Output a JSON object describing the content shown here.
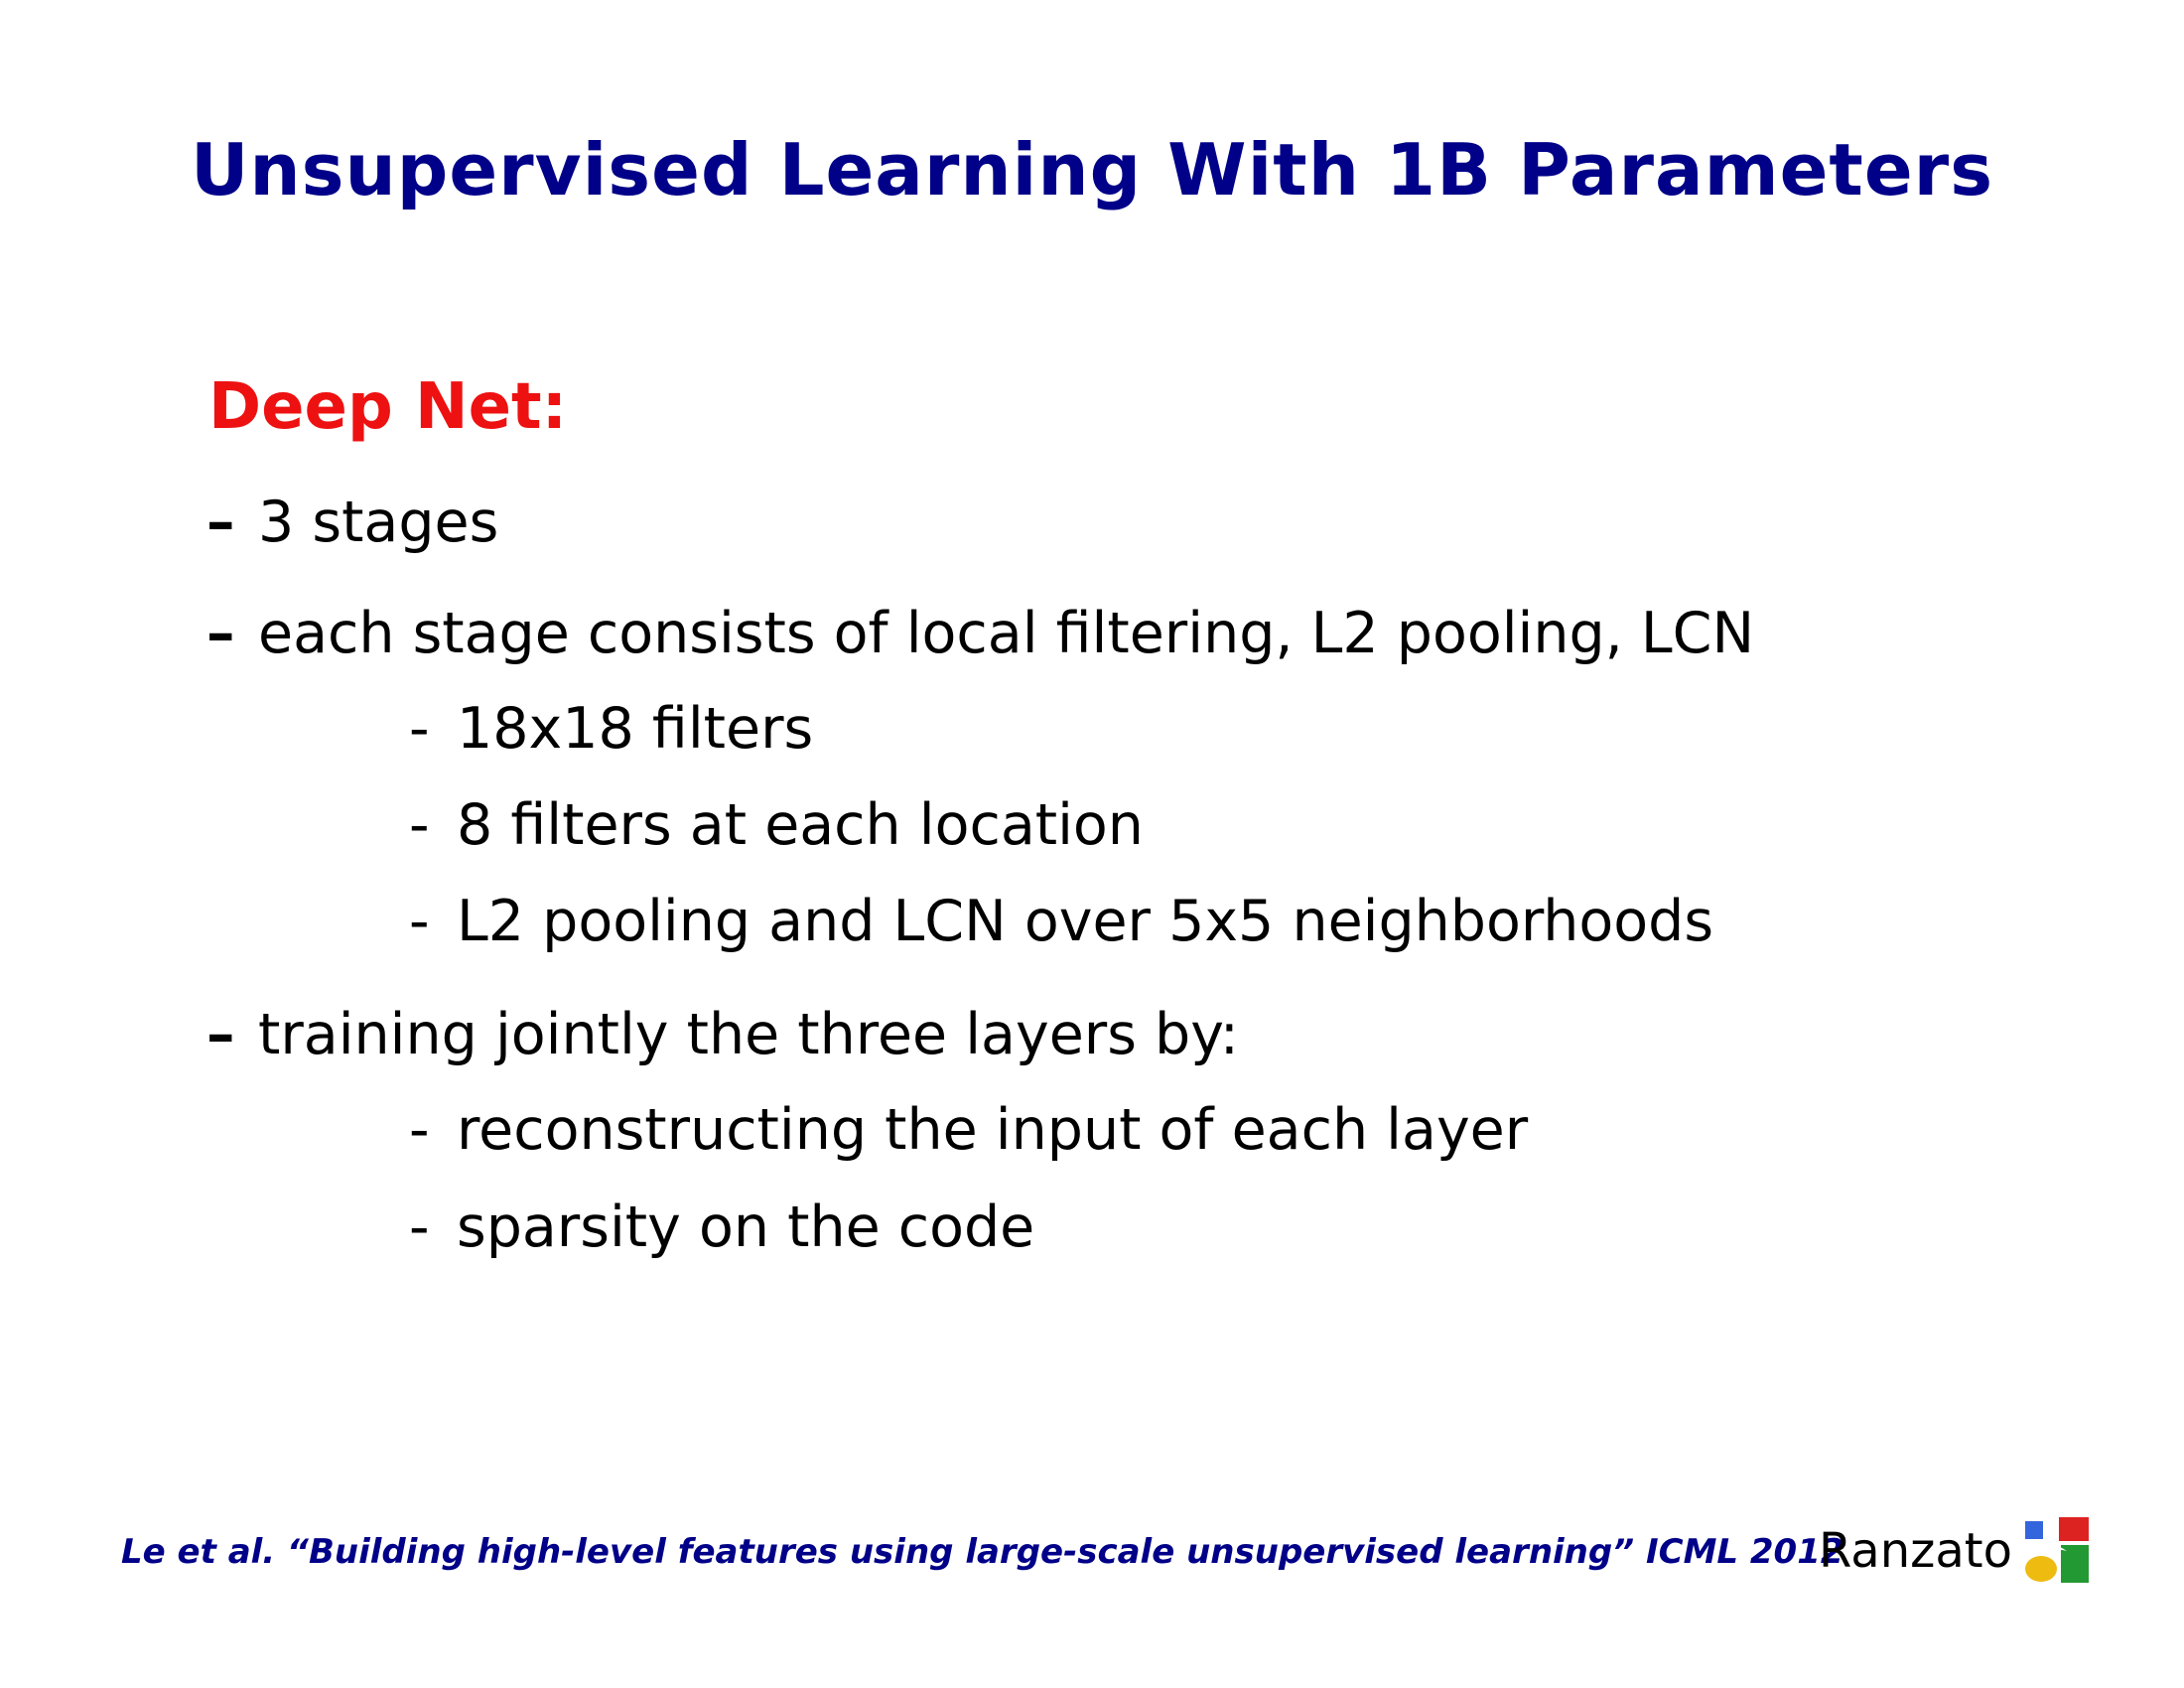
{
  "slide": {
    "title": "Unsupervised Learning With 1B Parameters",
    "section_heading": "Deep Net:",
    "bullets": [
      {
        "dash": "–",
        "text": "3 stages"
      },
      {
        "dash": "–",
        "text": "each stage consists of local filtering, L2 pooling, LCN"
      },
      {
        "dash": "–",
        "text": "training jointly the three layers by:"
      }
    ],
    "sub_bullets_stage": [
      {
        "dash": "-",
        "text": "18x18 filters"
      },
      {
        "dash": "-",
        "text": "8 filters at each location"
      },
      {
        "dash": "-",
        "text": "L2 pooling and LCN over 5x5 neighborhoods"
      }
    ],
    "sub_bullets_training": [
      {
        "dash": "-",
        "text": "reconstructing the input of each layer"
      },
      {
        "dash": "-",
        "text": "sparsity on the code"
      }
    ],
    "footer": {
      "citation": "Le et al. “Building high-level features using large-scale unsupervised learning” ICML 2012",
      "author": "Ranzato"
    },
    "logo_icon": "google-logo-icon",
    "colors": {
      "title": "#000088",
      "heading": "#ee1111",
      "text": "#000000",
      "logo_blue": "#3366dd",
      "logo_red": "#dd2222",
      "logo_yellow": "#eebb11",
      "logo_green": "#229933"
    }
  }
}
